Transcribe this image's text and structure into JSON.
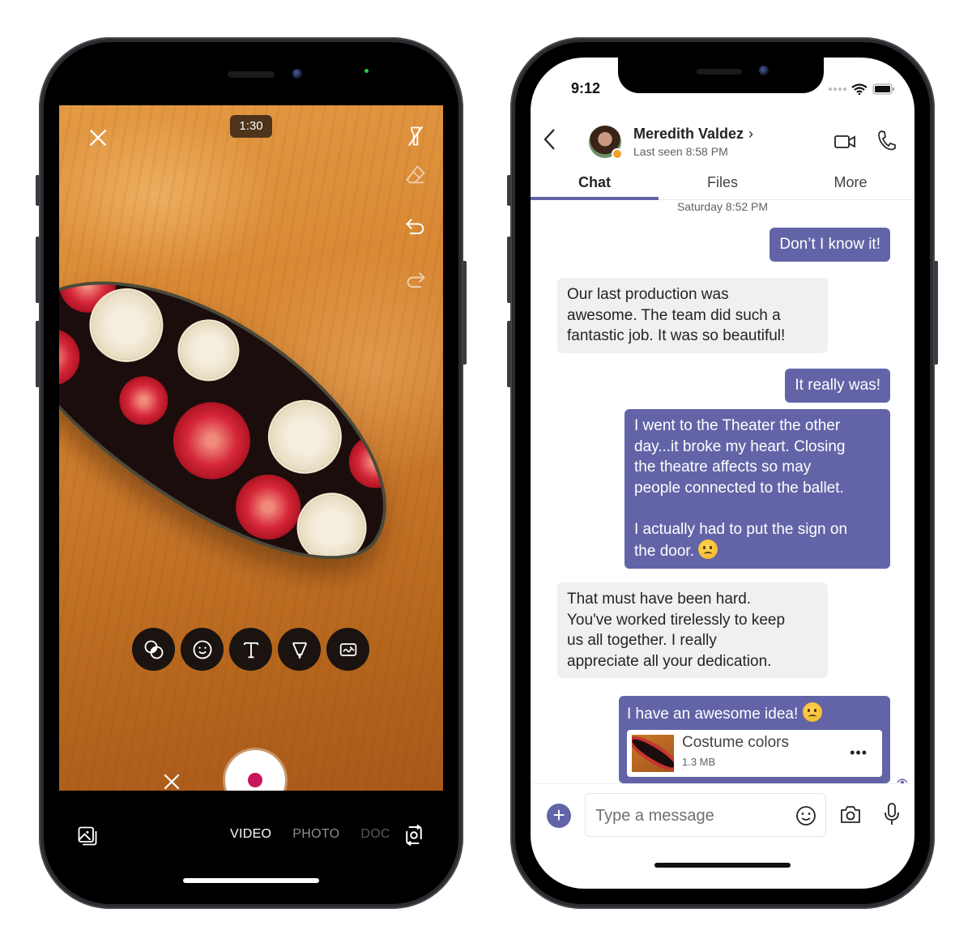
{
  "camera_screen": {
    "timer": "1:30",
    "top_icons": [
      "close-icon",
      "flashlight-off-icon",
      "eraser-icon",
      "undo-icon",
      "redo-icon"
    ],
    "edit_tools": [
      {
        "name": "filters",
        "icon": "filters-icon"
      },
      {
        "name": "stickers",
        "icon": "sticker-smile-icon"
      },
      {
        "name": "text",
        "icon": "text-icon"
      },
      {
        "name": "pen",
        "icon": "pen-icon"
      },
      {
        "name": "whiteboard",
        "icon": "whiteboard-icon"
      }
    ],
    "record_color": "#c8185a",
    "modes": [
      {
        "label": "VIDEO",
        "active": true
      },
      {
        "label": "PHOTO",
        "active": false
      },
      {
        "label": "DOC",
        "active": false
      }
    ]
  },
  "chat_screen": {
    "status_bar": {
      "time": "9:12"
    },
    "header": {
      "contact_name": "Meredith Valdez",
      "chevron": "›",
      "last_seen": "Last seen 8:58 PM"
    },
    "tabs": [
      {
        "label": "Chat",
        "active": true
      },
      {
        "label": "Files",
        "active": false
      },
      {
        "label": "More",
        "active": false
      }
    ],
    "accent_color": "#6264a7",
    "day_stamp": "Saturday 8:52 PM",
    "messages": [
      {
        "direction": "out",
        "text": "Don’t I know it!"
      },
      {
        "direction": "in",
        "lines": [
          "Our last production was",
          "awesome. The team did such a",
          "fantastic job. It was so beautiful!"
        ]
      },
      {
        "direction": "out",
        "text": "It really was!"
      },
      {
        "direction": "out",
        "lines": [
          "I went to the Theater the other",
          "day...it broke my heart. Closing",
          "the theatre affects so may",
          "people connected to the ballet.",
          "",
          "I actually had to put the sign on",
          "the door."
        ],
        "emoji": "crying-sad-emoji"
      },
      {
        "direction": "in",
        "lines": [
          "That must have been hard.",
          "You've worked tirelessly to keep",
          "us all together. I really",
          "appreciate all your  dedication."
        ]
      },
      {
        "direction": "out",
        "text": "I have an awesome idea!",
        "emoji": "shushing-smile-emoji",
        "attachment": {
          "name": "Costume colors",
          "size": "1.3 MB",
          "more": "•••"
        }
      }
    ],
    "compose": {
      "placeholder": "Type a message",
      "add_label": "+"
    }
  }
}
